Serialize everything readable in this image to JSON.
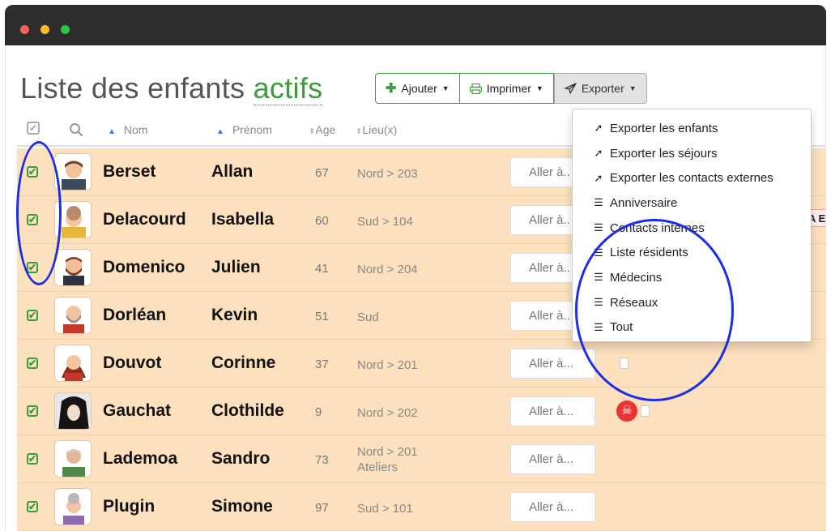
{
  "header": {
    "title_prefix": "Liste des enfants",
    "title_accent": "actifs"
  },
  "toolbar": {
    "ajouter_label": "Ajouter",
    "imprimer_label": "Imprimer",
    "exporter_label": "Exporter"
  },
  "table": {
    "columns": [
      "Nom",
      "Prénom",
      "Age",
      "Lieu(x)"
    ],
    "action_label": "Aller à...",
    "action_label_truncated": "Aller à..",
    "tag_label": "A EV",
    "rows": [
      {
        "nom": "Berset",
        "prenom": "Allan",
        "age": "67",
        "lieu1": "Nord > 203",
        "lieu2": ""
      },
      {
        "nom": "Delacourd",
        "prenom": "Isabella",
        "age": "60",
        "lieu1": "Sud > 104",
        "lieu2": ""
      },
      {
        "nom": "Domenico",
        "prenom": "Julien",
        "age": "41",
        "lieu1": "Nord > 204",
        "lieu2": ""
      },
      {
        "nom": "Dorléan",
        "prenom": "Kevin",
        "age": "51",
        "lieu1": "Sud",
        "lieu2": ""
      },
      {
        "nom": "Douvot",
        "prenom": "Corinne",
        "age": "37",
        "lieu1": "Nord > 201",
        "lieu2": ""
      },
      {
        "nom": "Gauchat",
        "prenom": "Clothilde",
        "age": "9",
        "lieu1": "Nord > 202",
        "lieu2": ""
      },
      {
        "nom": "Lademoa",
        "prenom": "Sandro",
        "age": "73",
        "lieu1": "Nord > 201",
        "lieu2": "Ateliers"
      },
      {
        "nom": "Plugin",
        "prenom": "Simone",
        "age": "97",
        "lieu1": "Sud > 101",
        "lieu2": ""
      }
    ]
  },
  "export_menu": {
    "items": [
      {
        "label": "Exporter les enfants",
        "icon": "paper-plane-icon"
      },
      {
        "label": "Exporter les séjours",
        "icon": "paper-plane-icon"
      },
      {
        "label": "Exporter les contacts externes",
        "icon": "paper-plane-icon"
      },
      {
        "label": "Anniversaire",
        "icon": "list-icon"
      },
      {
        "label": "Contacts internes",
        "icon": "list-icon"
      },
      {
        "label": "Liste résidents",
        "icon": "list-icon"
      },
      {
        "label": "Médecins",
        "icon": "list-icon"
      },
      {
        "label": "Réseaux",
        "icon": "list-icon"
      },
      {
        "label": "Tout",
        "icon": "list-icon"
      }
    ]
  },
  "colors": {
    "row_background": "#fde0bd",
    "accent_green": "#3c9b3c",
    "annotation_blue": "#1a2ee8",
    "window_bar": "#2d2d2d"
  }
}
